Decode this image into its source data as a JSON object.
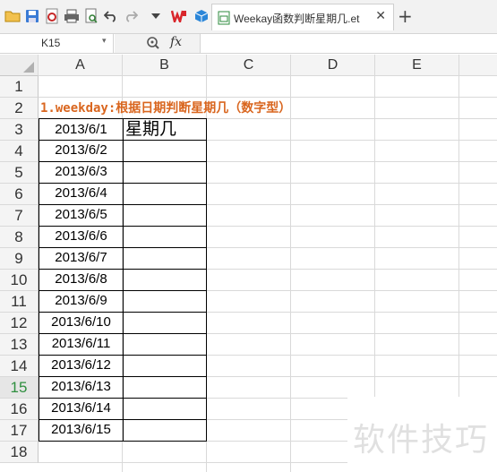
{
  "toolbar": {
    "icons": [
      "open-folder-icon",
      "save-icon",
      "export-pdf-icon",
      "print-icon",
      "print-preview-icon",
      "undo-icon",
      "redo-icon",
      "dropdown-icon",
      "wps-logo-icon",
      "cube-icon"
    ]
  },
  "tab": {
    "title": "Weekay函数判断星期几.et",
    "close": "✕"
  },
  "tab_add": "+",
  "formula_bar": {
    "cell_ref": "K15",
    "dropdown": "▾",
    "zoom_icon": "🔍",
    "fx": "fx",
    "formula": ""
  },
  "columns": [
    "A",
    "B",
    "C",
    "D",
    "E"
  ],
  "rows": [
    "1",
    "2",
    "3",
    "4",
    "5",
    "6",
    "7",
    "8",
    "9",
    "10",
    "11",
    "12",
    "13",
    "14",
    "15",
    "16",
    "17",
    "18"
  ],
  "active_row": "15",
  "sheet": {
    "title": "1.weekday:根据日期判断星期几（数字型）",
    "header_b3": "星期几",
    "dates": [
      "2013/6/1",
      "2013/6/2",
      "2013/6/3",
      "2013/6/4",
      "2013/6/5",
      "2013/6/6",
      "2013/6/7",
      "2013/6/8",
      "2013/6/9",
      "2013/6/10",
      "2013/6/11",
      "2013/6/12",
      "2013/6/13",
      "2013/6/14",
      "2013/6/15"
    ]
  },
  "watermark": "软件技巧",
  "colors": {
    "title": "#d9661f",
    "active_row": "#2f8f3f",
    "wps_red": "#d9262b",
    "cube_blue": "#2b86d8"
  }
}
